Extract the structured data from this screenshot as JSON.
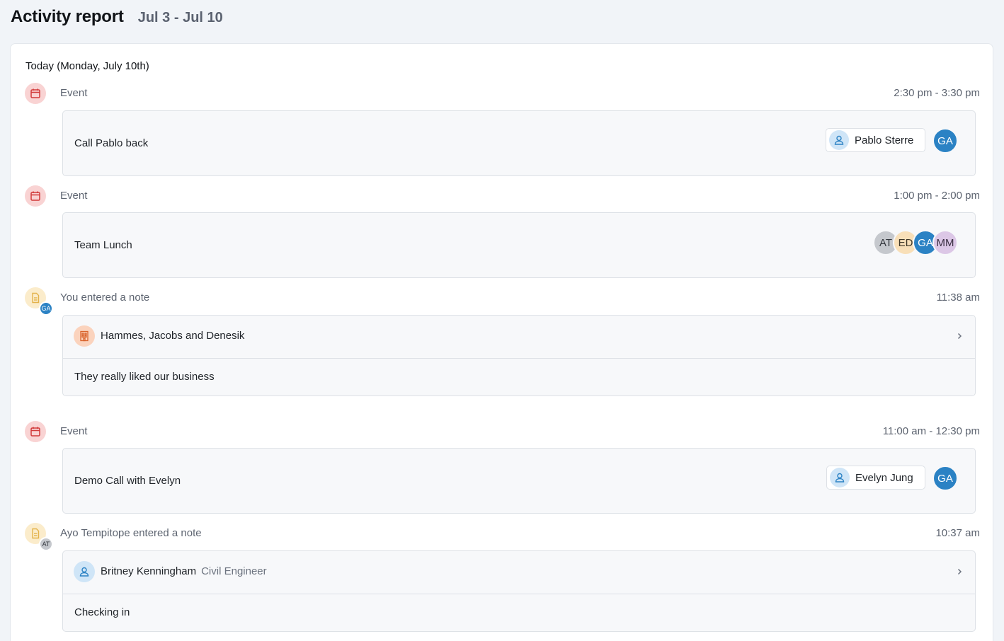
{
  "header": {
    "title": "Activity report",
    "range": "Jul 3 - Jul 10"
  },
  "day": {
    "heading": "Today (Monday, July 10th)"
  },
  "activities": [
    {
      "kind": "event",
      "type_label": "Event",
      "time": "2:30 pm - 3:30 pm",
      "title": "Call Pablo back",
      "contact": "Pablo Sterre",
      "attendees": [
        "GA"
      ]
    },
    {
      "kind": "event",
      "type_label": "Event",
      "time": "1:00 pm - 2:00 pm",
      "title": "Team Lunch",
      "attendees": [
        "AT",
        "ED",
        "GA",
        "MM"
      ]
    },
    {
      "kind": "note",
      "author_initials": "GA",
      "type_label": "You entered a note",
      "time": "11:38 am",
      "entity": "Hammes, Jacobs and Denesik",
      "entity_icon": "building-icon",
      "body": "They really liked our business"
    },
    {
      "kind": "event",
      "type_label": "Event",
      "time": "11:00 am - 12:30 pm",
      "title": "Demo Call with Evelyn",
      "contact": "Evelyn Jung",
      "attendees": [
        "GA"
      ]
    },
    {
      "kind": "note",
      "author_initials": "AT",
      "type_label": "Ayo Tempitope entered a note",
      "time": "10:37 am",
      "entity": "Britney Kenningham",
      "entity_subtitle": "Civil Engineer",
      "entity_icon": "person-icon",
      "body": "Checking in"
    }
  ],
  "colors": {
    "event_icon": "#d13a3a",
    "note_icon": "#e3b24a",
    "company_icon": "#d9632c",
    "person_icon": "#2b82c4",
    "avatar_ga": "#2b82c4"
  }
}
